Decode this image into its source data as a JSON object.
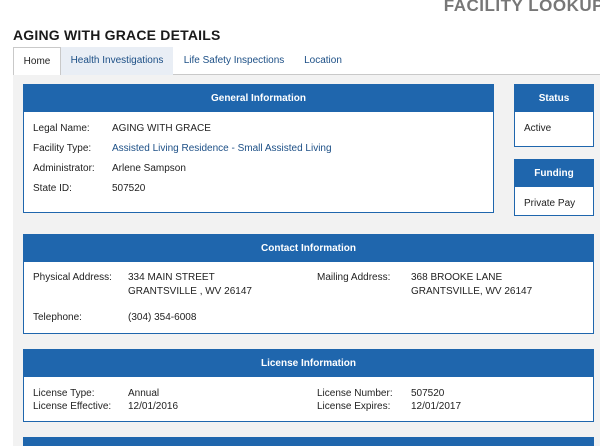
{
  "header": {
    "top_title": "FACILITY LOOKUP",
    "page_title": "AGING WITH GRACE DETAILS"
  },
  "tabs": [
    {
      "label": "Home",
      "active": true
    },
    {
      "label": "Health Investigations",
      "active": false
    },
    {
      "label": "Life Safety Inspections",
      "active": false
    },
    {
      "label": "Location",
      "active": false
    }
  ],
  "general": {
    "title": "General Information",
    "legal_name_label": "Legal Name:",
    "legal_name": "AGING WITH GRACE",
    "facility_type_label": "Facility Type:",
    "facility_type": "Assisted Living Residence - Small Assisted Living",
    "administrator_label": "Administrator:",
    "administrator": "Arlene Sampson",
    "state_id_label": "State ID:",
    "state_id": "507520"
  },
  "status": {
    "title": "Status",
    "value": "Active"
  },
  "funding": {
    "title": "Funding",
    "value": "Private Pay"
  },
  "contact": {
    "title": "Contact Information",
    "physical_label": "Physical Address:",
    "physical_line1": "334 MAIN STREET",
    "physical_line2": "GRANTSVILLE , WV 26147",
    "mailing_label": "Mailing Address:",
    "mailing_line1": "368 BROOKE LANE",
    "mailing_line2": "GRANTSVILLE, WV 26147",
    "telephone_label": "Telephone:",
    "telephone": "(304) 354-6008"
  },
  "license": {
    "title": "License Information",
    "type_label": "License Type:",
    "type": "Annual",
    "effective_label": "License Effective:",
    "effective": "12/01/2016",
    "number_label": "License Number:",
    "number": "507520",
    "expires_label": "License Expires:",
    "expires": "12/01/2017"
  },
  "colors": {
    "panel_header": "#1f66ad",
    "link": "#1c4f86",
    "background": "#f2f2f2"
  }
}
